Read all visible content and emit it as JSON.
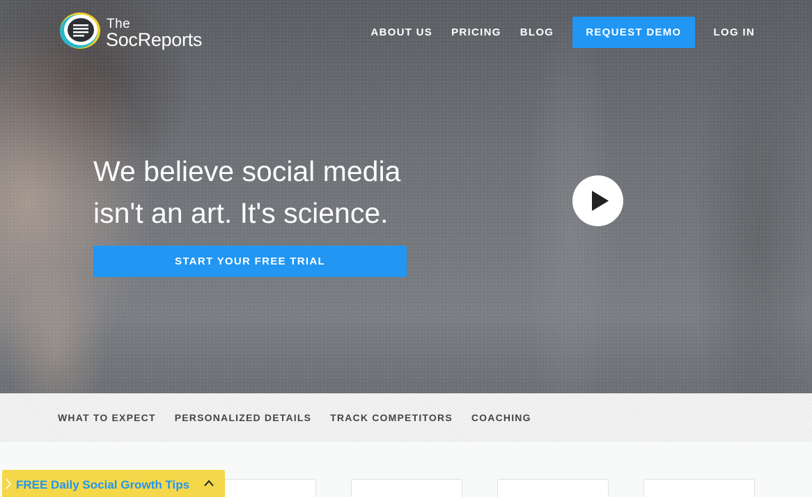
{
  "brand": {
    "logo_the": "The",
    "logo_name": "SocReports",
    "colors": {
      "accent": "#2196f3",
      "logo_yellow": "#f2d22e",
      "logo_teal": "#2ab7c9",
      "promo_bg": "#f5d84a"
    }
  },
  "nav": {
    "items": [
      "ABOUT US",
      "PRICING",
      "BLOG"
    ],
    "cta": "REQUEST DEMO",
    "login": "LOG IN"
  },
  "hero": {
    "headline_line1": "We believe social media",
    "headline_line2": "isn't an art. It's science.",
    "trial_button": "START YOUR FREE TRIAL",
    "play_icon": "play-icon"
  },
  "tabs": [
    "WHAT TO EXPECT",
    "PERSONALIZED DETAILS",
    "TRACK COMPETITORS",
    "COACHING"
  ],
  "promo": {
    "text": "FREE Daily Social Growth Tips",
    "left_icon": "chevron-right-icon",
    "right_icon": "chevron-up-icon"
  }
}
